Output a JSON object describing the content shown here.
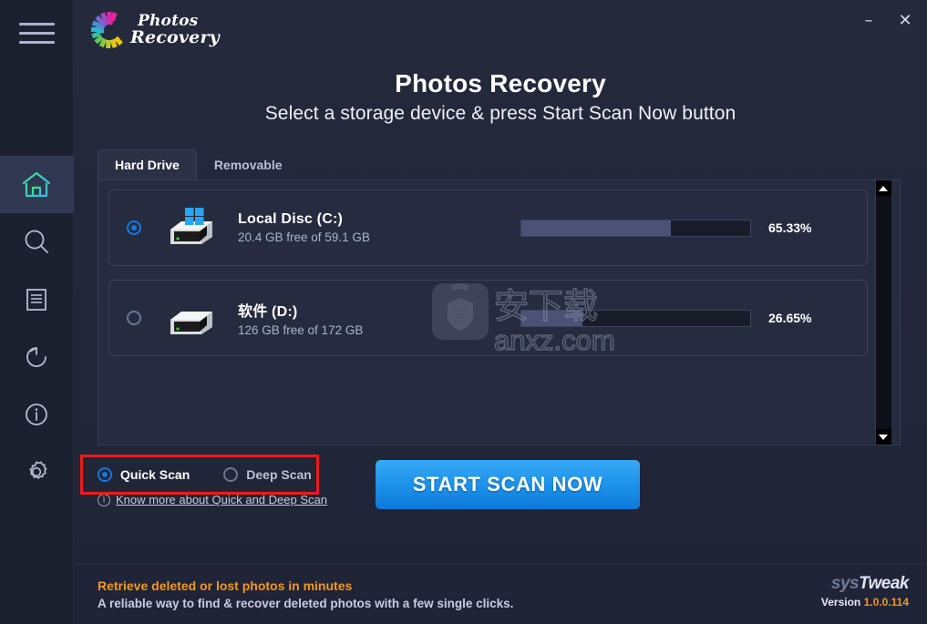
{
  "window": {
    "minimize_label": "–",
    "close_label": "✕"
  },
  "brand": {
    "line1": "Photos",
    "line2": "Recovery"
  },
  "sidebar": {
    "menu_icon": "hamburger-icon",
    "items": [
      {
        "icon": "home-icon",
        "name": "home",
        "active": true
      },
      {
        "icon": "search-icon",
        "name": "search",
        "active": false
      },
      {
        "icon": "list-icon",
        "name": "list",
        "active": false
      },
      {
        "icon": "restore-icon",
        "name": "restore",
        "active": false
      },
      {
        "icon": "info-icon",
        "name": "info",
        "active": false
      },
      {
        "icon": "settings-icon",
        "name": "settings",
        "active": false
      }
    ]
  },
  "header": {
    "title": "Photos Recovery",
    "subtitle": "Select a storage device & press Start Scan Now button"
  },
  "tabs": [
    {
      "label": "Hard Drive",
      "active": true
    },
    {
      "label": "Removable",
      "active": false
    }
  ],
  "devices": [
    {
      "name": "Local Disc (C:)",
      "capacity_text": "20.4 GB free of 59.1 GB",
      "percent_label": "65.33%",
      "percent_value": 65.33,
      "selected": true,
      "icon": "windows-drive-icon"
    },
    {
      "name": "软件 (D:)",
      "capacity_text": "126 GB free of 172 GB",
      "percent_label": "26.65%",
      "percent_value": 26.65,
      "selected": false,
      "icon": "drive-icon"
    }
  ],
  "scan": {
    "quick_label": "Quick Scan",
    "deep_label": "Deep Scan",
    "selected": "quick",
    "know_more": "Know more about Quick and Deep Scan",
    "start_button": "START SCAN NOW"
  },
  "footer": {
    "tagline": "Retrieve deleted or lost photos in minutes",
    "description": "A reliable way to find & recover deleted photos with a few single clicks.",
    "logo_part1": "sys",
    "logo_part2": "Tweak",
    "version_label": "Version",
    "version_number": "1.0.0.114"
  },
  "watermark": {
    "text": "anxz.com",
    "cjk": "安下载",
    "badge": "安"
  },
  "colors": {
    "accent_blue": "#1f95ec",
    "annotation_red": "#ee1b1b",
    "orange": "#f2981f",
    "panel": "#262c3f",
    "sidebar": "#1c2130"
  }
}
